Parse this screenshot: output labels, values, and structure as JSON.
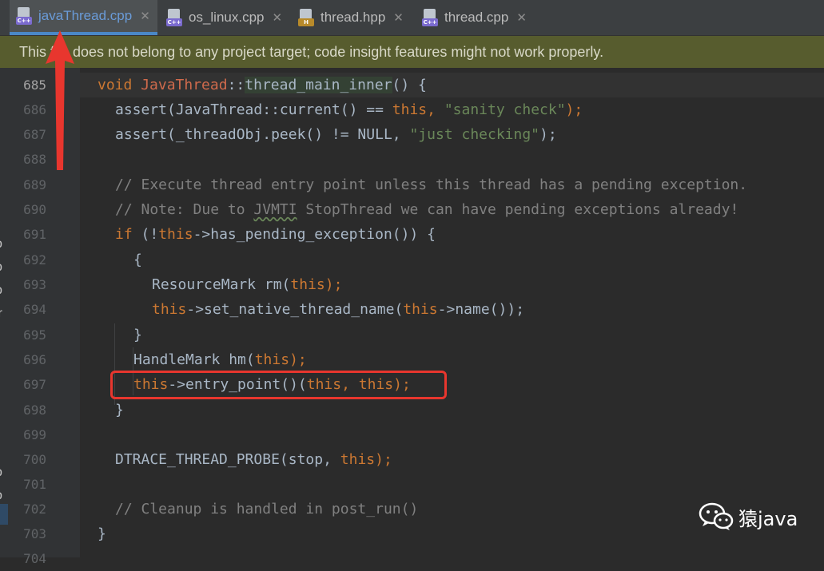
{
  "tabs": [
    {
      "label": "javaThread.cpp",
      "icon": "cpp-file-icon",
      "badge": "C++",
      "active": true
    },
    {
      "label": "os_linux.cpp",
      "icon": "cpp-file-icon",
      "badge": "C++",
      "active": false
    },
    {
      "label": "thread.hpp",
      "icon": "header-file-icon",
      "badge": "H",
      "active": false
    },
    {
      "label": "thread.cpp",
      "icon": "cpp-file-icon",
      "badge": "C++",
      "active": false
    }
  ],
  "banner": {
    "text": "This file does not belong to any project target; code insight features might not work properly."
  },
  "line_numbers": [
    "685",
    "686",
    "687",
    "688",
    "689",
    "690",
    "691",
    "692",
    "693",
    "694",
    "695",
    "696",
    "697",
    "698",
    "699",
    "700",
    "701",
    "702",
    "703",
    "704"
  ],
  "code": {
    "l685": {
      "kw_void": "void",
      "cls": "JavaThread",
      "sep": "::",
      "fn": "thread_main_inner",
      "rest": "() {"
    },
    "l686": {
      "a": "assert(JavaThread::current() == ",
      "this": "this",
      "b": ", ",
      "str": "\"sanity check\"",
      "c": ");"
    },
    "l687": {
      "a": "assert(_threadObj.peek() != NULL, ",
      "str": "\"just checking\"",
      "c": ");"
    },
    "l689": "// Execute thread entry point unless this thread has a pending exception.",
    "l690": {
      "a": "// Note: Due to ",
      "wavy": "JVMTI",
      "b": " StopThread we can have pending exceptions already!"
    },
    "l691": {
      "kw_if": "if",
      "a": " (!",
      "this": "this",
      "b": "->has_pending_exception()) {"
    },
    "l692": "{",
    "l693": {
      "a": "ResourceMark rm(",
      "this": "this",
      "b": ");"
    },
    "l694": {
      "this1": "this",
      "a": "->set_native_thread_name(",
      "this2": "this",
      "b": "->name());"
    },
    "l695": "}",
    "l696": {
      "a": "HandleMark hm(",
      "this": "this",
      "b": ");"
    },
    "l697": {
      "this1": "this",
      "a": "->entry_point()(",
      "this2": "this",
      "b": ", ",
      "this3": "this",
      "c": ");"
    },
    "l698": "}",
    "l700": {
      "a": "DTRACE_THREAD_PROBE(stop, ",
      "this": "this",
      "b": ");"
    },
    "l702": "// Cleanup is handled in post_run()",
    "l703": "}"
  },
  "left_strip_chars": [
    "p",
    "p",
    "p",
    "ir",
    "p",
    "p"
  ],
  "watermark": {
    "text": "猿java",
    "icon": "wechat-icon"
  },
  "colors": {
    "keyword": "#cc7832",
    "string": "#6a8759",
    "comment": "#808080",
    "class_name": "#cf6a4c",
    "banner_bg": "#575c2e",
    "highlight_box": "#e8362e"
  }
}
